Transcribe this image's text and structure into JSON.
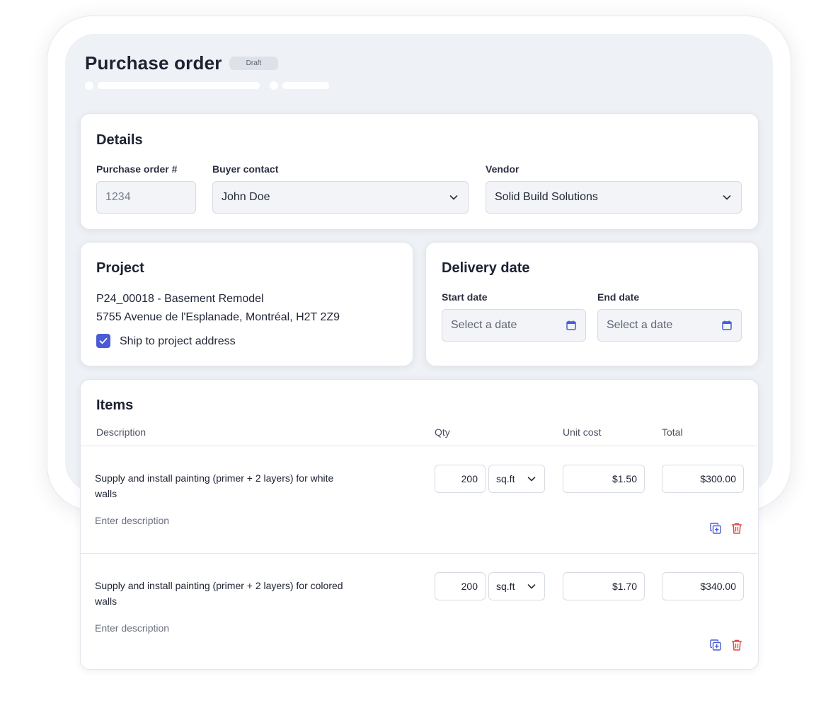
{
  "header": {
    "title": "Purchase order",
    "status": "Draft"
  },
  "details": {
    "title": "Details",
    "po_number": {
      "label": "Purchase order #",
      "value": "1234"
    },
    "buyer_contact": {
      "label": "Buyer contact",
      "value": "John Doe"
    },
    "vendor": {
      "label": "Vendor",
      "value": "Solid Build Solutions"
    }
  },
  "project": {
    "title": "Project",
    "name": "P24_00018 - Basement Remodel",
    "address": "5755 Avenue de l'Esplanade, Montréal, H2T 2Z9",
    "ship_to_address": {
      "label": "Ship to project address",
      "checked": true
    }
  },
  "delivery": {
    "title": "Delivery date",
    "start": {
      "label": "Start date",
      "placeholder": "Select a date"
    },
    "end": {
      "label": "End date",
      "placeholder": "Select a date"
    }
  },
  "items": {
    "title": "Items",
    "columns": {
      "description": "Description",
      "qty": "Qty",
      "unit_cost": "Unit cost",
      "total": "Total"
    },
    "rows": [
      {
        "description": "Supply and install painting (primer + 2 layers) for white walls",
        "note_placeholder": "Enter description",
        "qty": "200",
        "unit": "sq.ft",
        "unit_cost": "$1.50",
        "total": "$300.00"
      },
      {
        "description": "Supply and install painting (primer + 2 layers) for colored walls",
        "note_placeholder": "Enter description",
        "qty": "200",
        "unit": "sq.ft",
        "unit_cost": "$1.70",
        "total": "$340.00"
      }
    ]
  },
  "colors": {
    "accent": "#4b5bd6",
    "danger": "#e04848",
    "page_bg": "#eef1f5"
  },
  "icons": {
    "dropdown": "chevron-down-icon",
    "calendar": "calendar-icon",
    "check": "check-icon",
    "duplicate": "duplicate-icon",
    "delete": "trash-icon"
  }
}
